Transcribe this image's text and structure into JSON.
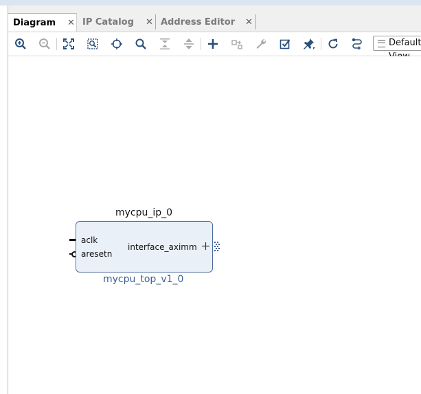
{
  "tabs": [
    {
      "label": "Diagram",
      "active": true
    },
    {
      "label": "IP Catalog",
      "active": false
    },
    {
      "label": "Address Editor",
      "active": false
    }
  ],
  "toolbar": {
    "icons": [
      "zoom-in-icon",
      "zoom-out-icon",
      "zoom-fit-icon",
      "zoom-selection-icon",
      "center-icon",
      "search-icon",
      "collapse-all-icon",
      "expand-all-icon",
      "add-ip-icon",
      "make-connection-icon",
      "customize-icon",
      "validate-design-icon",
      "pin-icon",
      "regenerate-layout-icon",
      "optimize-routing-icon"
    ],
    "layout_select": "Default View"
  },
  "diagram": {
    "instance_name": "mycpu_ip_0",
    "module_name": "mycpu_top_v1_0",
    "pins_left": [
      "aclk",
      "aresetn"
    ],
    "pins_right": [
      "interface_aximm"
    ],
    "colors": {
      "block_fill": "#e9f0f8",
      "block_border": "#4d6c9c",
      "module_text": "#3a5f93"
    }
  }
}
